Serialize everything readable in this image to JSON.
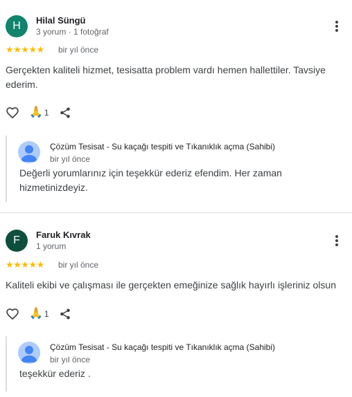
{
  "reviews": [
    {
      "avatar_letter": "H",
      "avatar_color": "#12846e",
      "author": "Hilal Süngü",
      "author_meta": "3 yorum · 1 fotoğraf",
      "rating": 5,
      "stars": "★★★★★",
      "date": "bir yıl önce",
      "text": "Gerçekten kaliteli hizmet, tesisatta problem vardı hemen hallettiler. Tavsiye ederim.",
      "like_icon": "heart-outline-icon",
      "thanks_icon": "pray-hands-icon",
      "thanks_count": "1",
      "share_icon": "share-icon",
      "reply": {
        "owner": "Çözüm Tesisat - Su kaçağı tespiti ve Tıkanıklık açma (Sahibi)",
        "date": "bir yıl önce",
        "text": "Değerli yorumlarınız için teşekkür ederiz efendim. Her zaman hizmetinizdeyiz."
      }
    },
    {
      "avatar_letter": "F",
      "avatar_color": "#0d4f3c",
      "author": "Faruk Kıvrak",
      "author_meta": "1 yorum",
      "rating": 5,
      "stars": "★★★★★",
      "date": "bir yıl önce",
      "text": "Kaliteli ekibi ve çalışması ile gerçekten emeğinize sağlık hayırlı işleriniz olsun",
      "like_icon": "heart-outline-icon",
      "thanks_icon": "pray-hands-icon",
      "thanks_count": "1",
      "share_icon": "share-icon",
      "reply": {
        "owner": "Çözüm Tesisat - Su kaçağı tespiti ve Tıkanıklık açma (Sahibi)",
        "date": "bir yıl önce",
        "text": "teşekkür ederiz ."
      }
    }
  ],
  "colors": {
    "star": "#fbbc04",
    "text": "#3c4043",
    "secondary_text": "#5f6368",
    "divider": "#dadce0",
    "owner_avatar_bg": "#aecbfa",
    "owner_avatar_fg": "#4285f4"
  }
}
